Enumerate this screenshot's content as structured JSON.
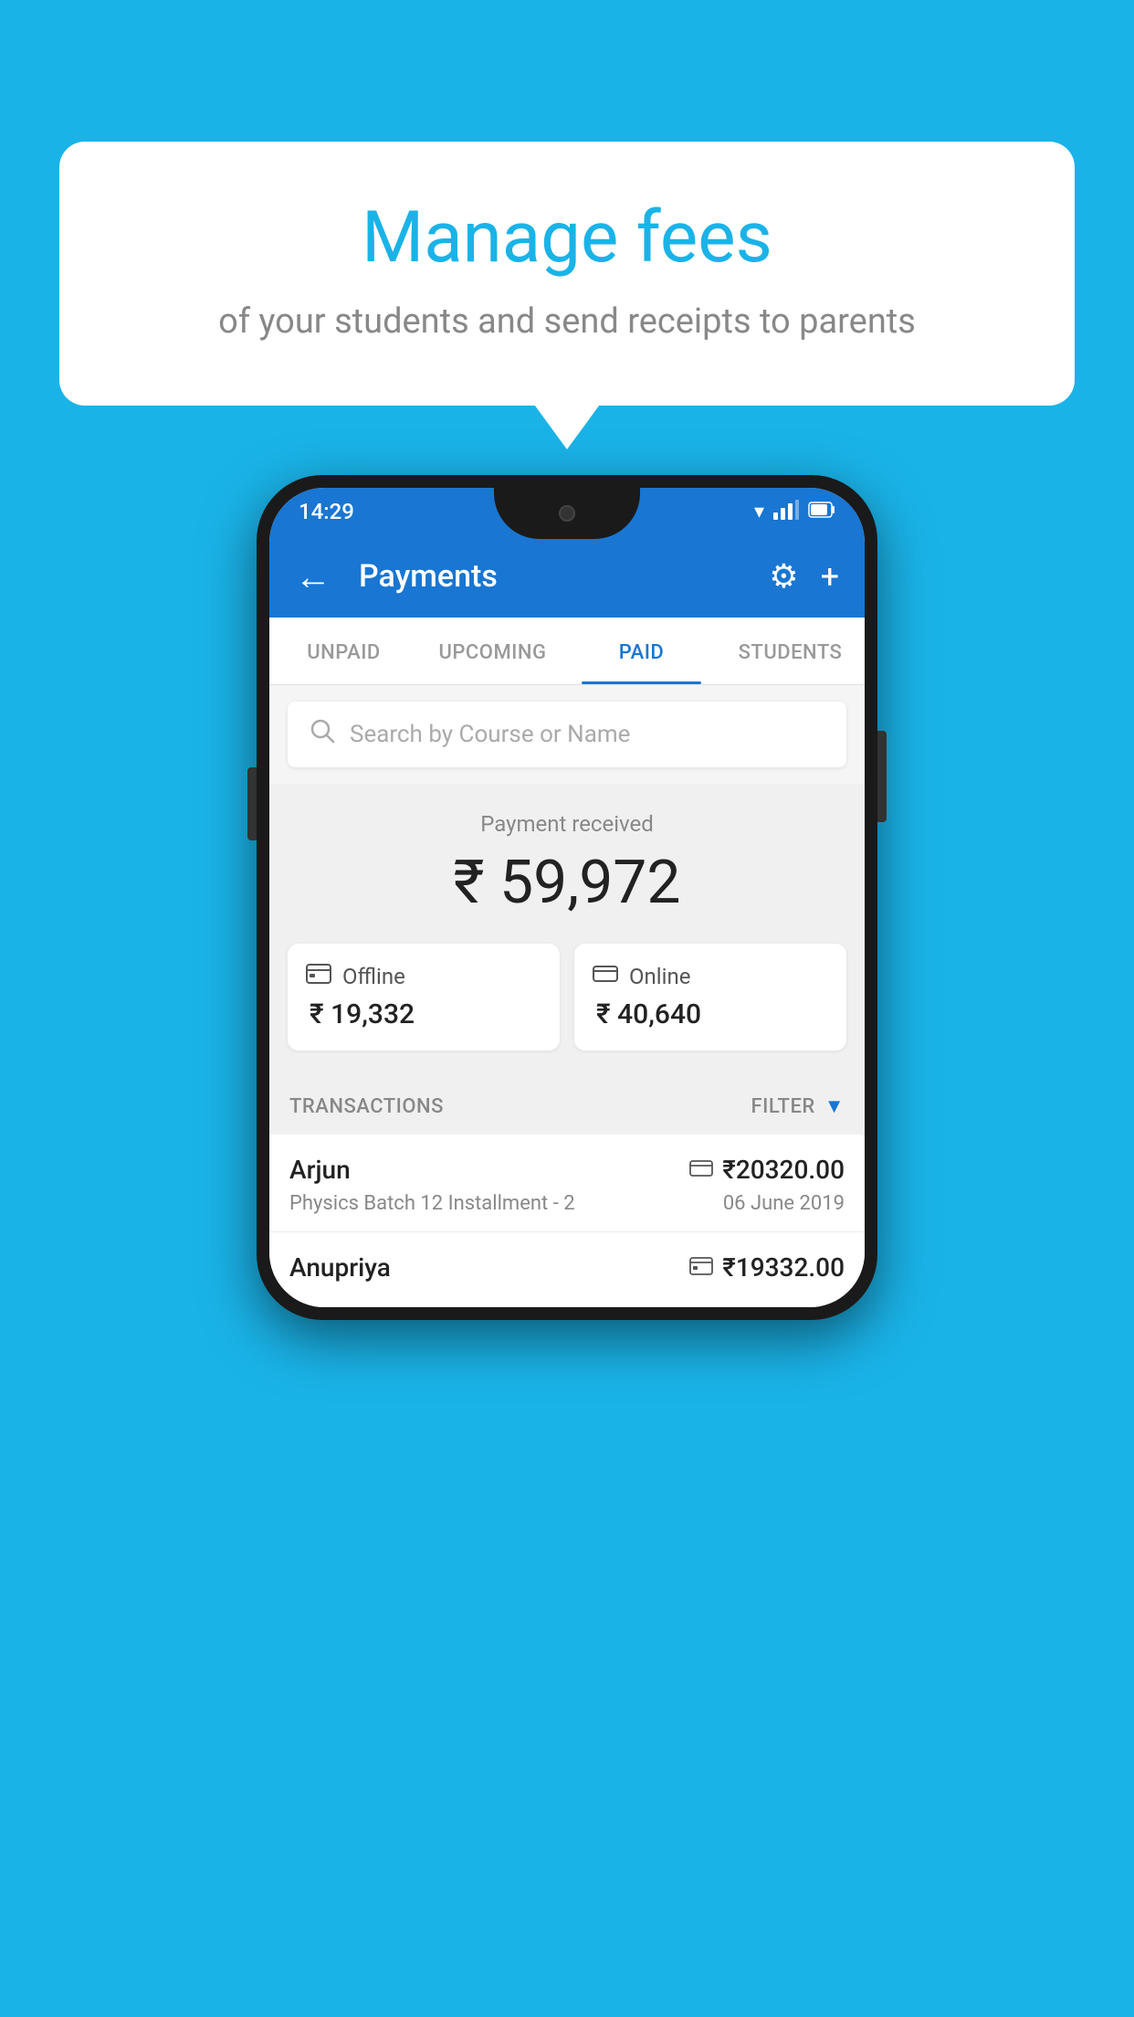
{
  "background_color": "#1ab3e8",
  "speech_bubble": {
    "heading": "Manage fees",
    "subtext": "of your students and send receipts to parents"
  },
  "status_bar": {
    "time": "14:29",
    "wifi": "▼▲",
    "signal": "▲",
    "battery": "▮"
  },
  "app_bar": {
    "title": "Payments",
    "back_icon": "←",
    "settings_icon": "⚙",
    "add_icon": "+"
  },
  "tabs": [
    {
      "label": "UNPAID",
      "active": false
    },
    {
      "label": "UPCOMING",
      "active": false
    },
    {
      "label": "PAID",
      "active": true
    },
    {
      "label": "STUDENTS",
      "active": false
    }
  ],
  "search": {
    "placeholder": "Search by Course or Name"
  },
  "payment_summary": {
    "label": "Payment received",
    "total": "₹ 59,972",
    "offline": {
      "label": "Offline",
      "amount": "₹ 19,332"
    },
    "online": {
      "label": "Online",
      "amount": "₹ 40,640"
    }
  },
  "transactions": {
    "section_label": "TRANSACTIONS",
    "filter_label": "FILTER",
    "rows": [
      {
        "name": "Arjun",
        "amount": "₹20320.00",
        "detail": "Physics Batch 12 Installment - 2",
        "date": "06 June 2019",
        "payment_type": "online"
      },
      {
        "name": "Anupriya",
        "amount": "₹19332.00",
        "detail": "",
        "date": "",
        "payment_type": "offline"
      }
    ]
  }
}
